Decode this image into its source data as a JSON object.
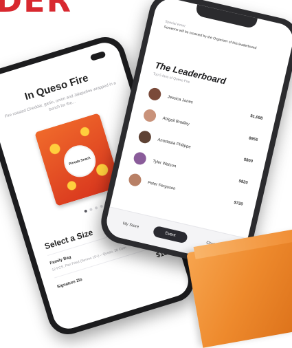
{
  "brand": {
    "text": "DER"
  },
  "left_phone": {
    "product_title": "In Queso Fire",
    "product_description": "Fire roasted Cheddar, garlic, onion and Jalapeños wrapped in a bunch for the...",
    "bag_label": "Pineda Snack",
    "carousel_dots": 4,
    "size_section_title": "Select a Size",
    "options": [
      {
        "name": "Family Bag",
        "note": "12 PCS, Pan Fried (Serves 10+) – Queso, 20 Corn",
        "price": ""
      },
      {
        "name": "Signature 2lb",
        "note": "",
        "price": "$18"
      }
    ]
  },
  "right_phone": {
    "event_label": "Special event",
    "event_text": "Someone will be crowned by the Organizer of this leaderboard",
    "leaderboard_title": "The Leaderboard",
    "leaderboard_subtitle": "Top 5 fans of Queso Fire",
    "entries": [
      {
        "name": "Jessica Jones",
        "amount": "$1,098",
        "color": "#7a4a3a"
      },
      {
        "name": "Abigail Bradley",
        "amount": "$955",
        "color": "#c9927a"
      },
      {
        "name": "Anastasia Philippe",
        "amount": "$800",
        "color": "#5e4234"
      },
      {
        "name": "Tyler Watson",
        "amount": "$820",
        "color": "#8a5c9a"
      },
      {
        "name": "Peter Ferguson",
        "amount": "$720",
        "color": "#b88066"
      }
    ],
    "tabs": [
      "My Store",
      "Event",
      "Chat"
    ],
    "active_tab": "Event"
  },
  "colors": {
    "accent": "#d8282f",
    "orange": "#ee8a2d",
    "dark": "#2a2a30"
  }
}
